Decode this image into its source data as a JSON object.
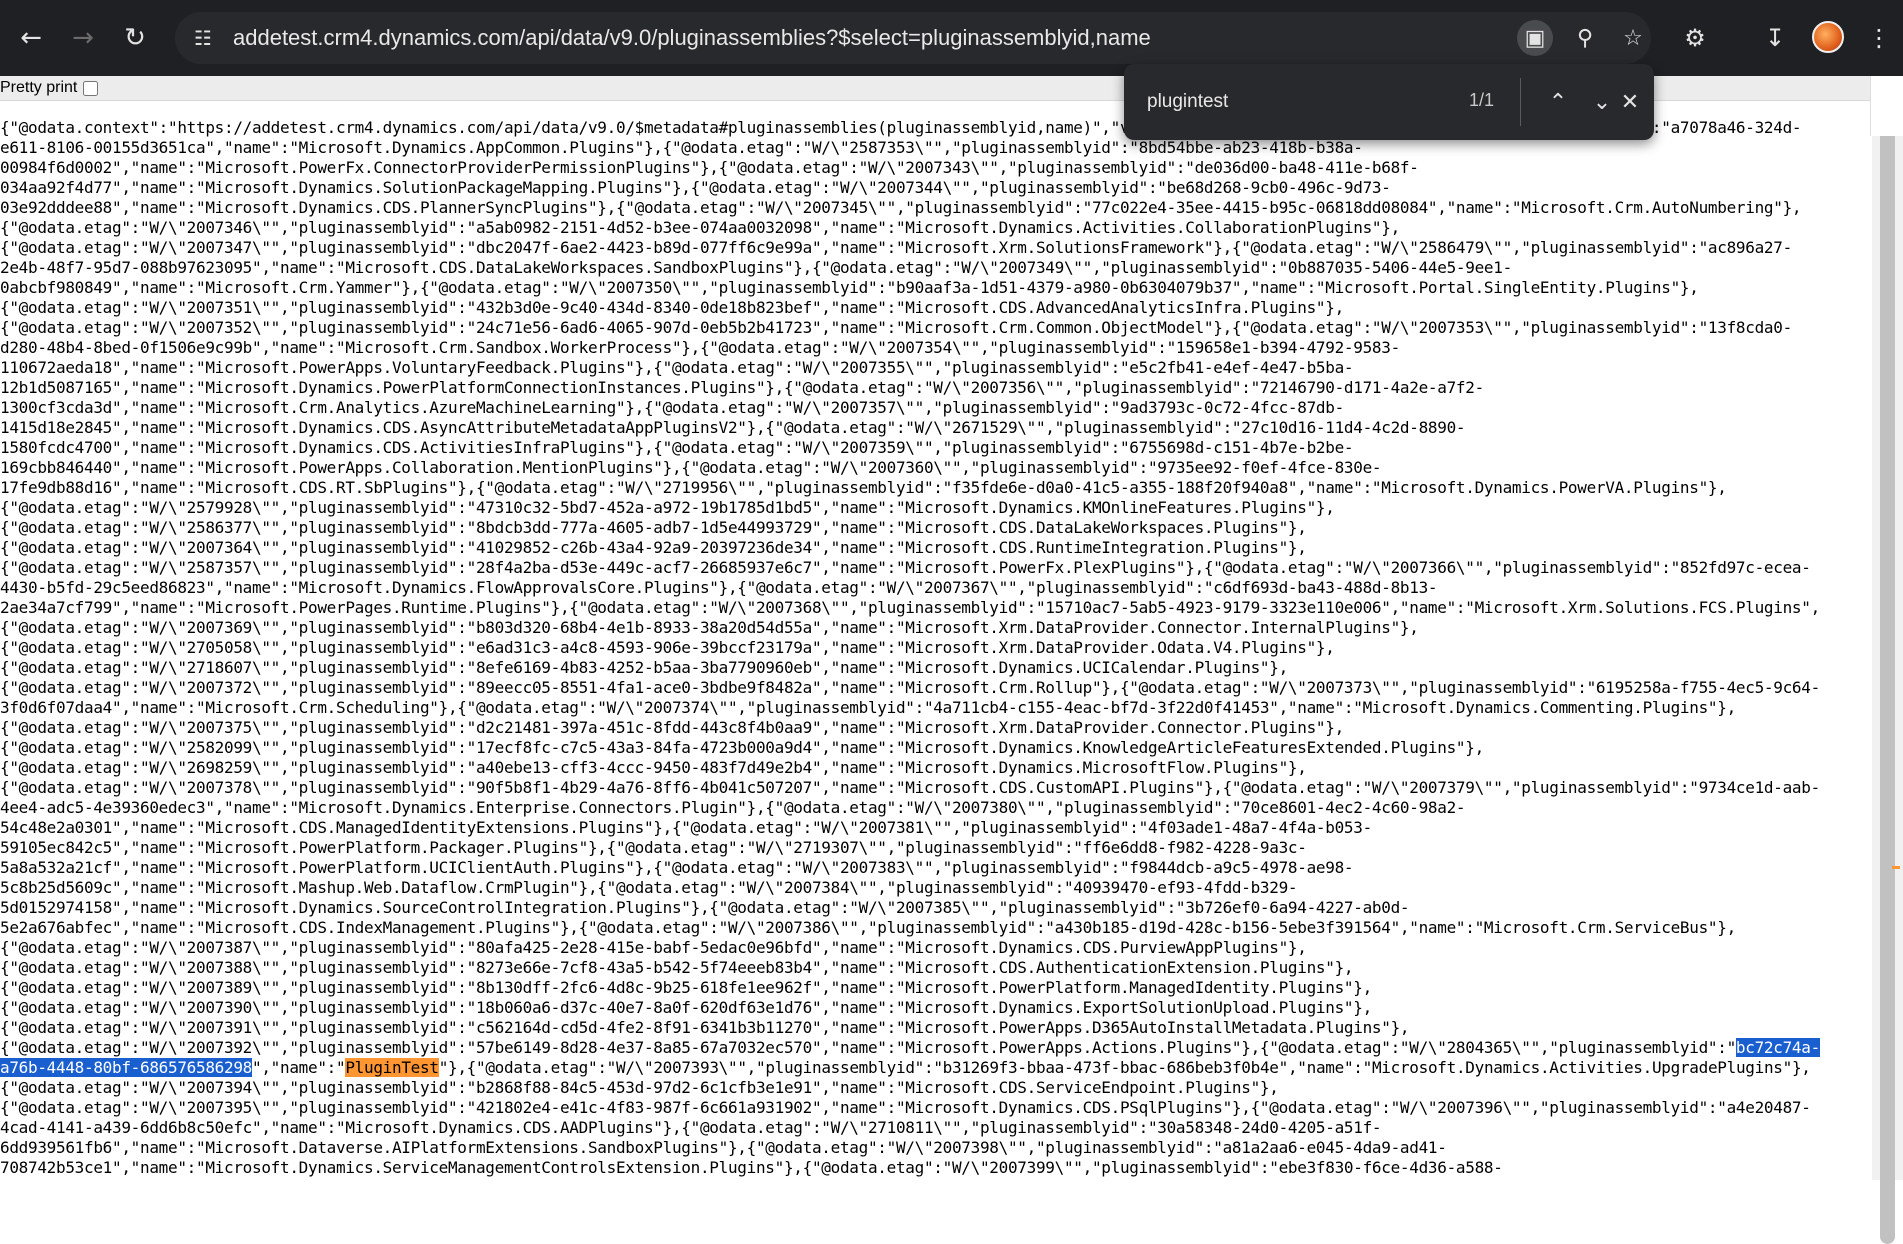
{
  "browser": {
    "url": "addetest.crm4.dynamics.com/api/data/v9.0/pluginassemblies?$select=pluginassemblyid,name",
    "icons": [
      "back-arrow-icon",
      "forward-arrow-icon",
      "reload-icon",
      "site-info-icon",
      "lens-icon",
      "zoom-icon",
      "bookmark-star-icon",
      "extensions-icon",
      "download-icon",
      "profile-avatar",
      "more-menu-icon"
    ]
  },
  "pretty_print": {
    "label": "Pretty print",
    "checked": false
  },
  "find_bar": {
    "query": "plugintest",
    "count": "1/1"
  },
  "json_text": {
    "lines": [
      "{\"@odata.context\":\"https://addetest.crm4.dynamics.com/api/data/v9.0/$metadata#pluginassemblies(pluginassemblyid,name)\",\"value\":[{\"@odata.etag\":\"W/\\\"2007339\\\"\",\"pluginassemblyid\":\"a7078a46-324d-",
      "e611-8106-00155d3651ca\",\"name\":\"Microsoft.Dynamics.AppCommon.Plugins\"},{\"@odata.etag\":\"W/\\\"2587353\\\"\",\"pluginassemblyid\":\"8bd54bbe-ab23-418b-b38a-",
      "00984f6d0002\",\"name\":\"Microsoft.PowerFx.ConnectorProviderPermissionPlugins\"},{\"@odata.etag\":\"W/\\\"2007343\\\"\",\"pluginassemblyid\":\"de036d00-ba48-411e-b68f-",
      "034aa92f4d77\",\"name\":\"Microsoft.Dynamics.SolutionPackageMapping.Plugins\"},{\"@odata.etag\":\"W/\\\"2007344\\\"\",\"pluginassemblyid\":\"be68d268-9cb0-496c-9d73-",
      "03e92dddee88\",\"name\":\"Microsoft.Dynamics.CDS.PlannerSyncPlugins\"},{\"@odata.etag\":\"W/\\\"2007345\\\"\",\"pluginassemblyid\":\"77c022e4-35ee-4415-b95c-06818dd08084\",\"name\":\"Microsoft.Crm.AutoNumbering\"},",
      "{\"@odata.etag\":\"W/\\\"2007346\\\"\",\"pluginassemblyid\":\"a5ab0982-2151-4d52-b3ee-074aa0032098\",\"name\":\"Microsoft.Dynamics.Activities.CollaborationPlugins\"},",
      "{\"@odata.etag\":\"W/\\\"2007347\\\"\",\"pluginassemblyid\":\"dbc2047f-6ae2-4423-b89d-077ff6c9e99a\",\"name\":\"Microsoft.Xrm.SolutionsFramework\"},{\"@odata.etag\":\"W/\\\"2586479\\\"\",\"pluginassemblyid\":\"ac896a27-",
      "2e4b-48f7-95d7-088b97623095\",\"name\":\"Microsoft.CDS.DataLakeWorkspaces.SandboxPlugins\"},{\"@odata.etag\":\"W/\\\"2007349\\\"\",\"pluginassemblyid\":\"0b887035-5406-44e5-9ee1-",
      "0abcbf980849\",\"name\":\"Microsoft.Crm.Yammer\"},{\"@odata.etag\":\"W/\\\"2007350\\\"\",\"pluginassemblyid\":\"b90aaf3a-1d51-4379-a980-0b6304079b37\",\"name\":\"Microsoft.Portal.SingleEntity.Plugins\"},",
      "{\"@odata.etag\":\"W/\\\"2007351\\\"\",\"pluginassemblyid\":\"432b3d0e-9c40-434d-8340-0de18b823bef\",\"name\":\"Microsoft.CDS.AdvancedAnalyticsInfra.Plugins\"},",
      "{\"@odata.etag\":\"W/\\\"2007352\\\"\",\"pluginassemblyid\":\"24c71e56-6ad6-4065-907d-0eb5b2b41723\",\"name\":\"Microsoft.Crm.Common.ObjectModel\"},{\"@odata.etag\":\"W/\\\"2007353\\\"\",\"pluginassemblyid\":\"13f8cda0-",
      "d280-48b4-8bed-0f1506e9c99b\",\"name\":\"Microsoft.Crm.Sandbox.WorkerProcess\"},{\"@odata.etag\":\"W/\\\"2007354\\\"\",\"pluginassemblyid\":\"159658e1-b394-4792-9583-",
      "110672aeda18\",\"name\":\"Microsoft.PowerApps.VoluntaryFeedback.Plugins\"},{\"@odata.etag\":\"W/\\\"2007355\\\"\",\"pluginassemblyid\":\"e5c2fb41-e4ef-4e47-b5ba-",
      "12b1d5087165\",\"name\":\"Microsoft.Dynamics.PowerPlatformConnectionInstances.Plugins\"},{\"@odata.etag\":\"W/\\\"2007356\\\"\",\"pluginassemblyid\":\"72146790-d171-4a2e-a7f2-",
      "1300cf3cda3d\",\"name\":\"Microsoft.Crm.Analytics.AzureMachineLearning\"},{\"@odata.etag\":\"W/\\\"2007357\\\"\",\"pluginassemblyid\":\"9ad3793c-0c72-4fcc-87db-",
      "1415d18e2845\",\"name\":\"Microsoft.Dynamics.CDS.AsyncAttributeMetadataAppPluginsV2\"},{\"@odata.etag\":\"W/\\\"2671529\\\"\",\"pluginassemblyid\":\"27c10d16-11d4-4c2d-8890-",
      "1580fcdc4700\",\"name\":\"Microsoft.Dynamics.CDS.ActivitiesInfraPlugins\"},{\"@odata.etag\":\"W/\\\"2007359\\\"\",\"pluginassemblyid\":\"6755698d-c151-4b7e-b2be-",
      "169cbb846440\",\"name\":\"Microsoft.PowerApps.Collaboration.MentionPlugins\"},{\"@odata.etag\":\"W/\\\"2007360\\\"\",\"pluginassemblyid\":\"9735ee92-f0ef-4fce-830e-",
      "17fe9db88d16\",\"name\":\"Microsoft.CDS.RT.SbPlugins\"},{\"@odata.etag\":\"W/\\\"2719956\\\"\",\"pluginassemblyid\":\"f35fde6e-d0a0-41c5-a355-188f20f940a8\",\"name\":\"Microsoft.Dynamics.PowerVA.Plugins\"},",
      "{\"@odata.etag\":\"W/\\\"2579928\\\"\",\"pluginassemblyid\":\"47310c32-5bd7-452a-a972-19b1785d1bd5\",\"name\":\"Microsoft.Dynamics.KMOnlineFeatures.Plugins\"},",
      "{\"@odata.etag\":\"W/\\\"2586377\\\"\",\"pluginassemblyid\":\"8bdcb3dd-777a-4605-adb7-1d5e44993729\",\"name\":\"Microsoft.CDS.DataLakeWorkspaces.Plugins\"},",
      "{\"@odata.etag\":\"W/\\\"2007364\\\"\",\"pluginassemblyid\":\"41029852-c26b-43a4-92a9-20397236de34\",\"name\":\"Microsoft.CDS.RuntimeIntegration.Plugins\"},",
      "{\"@odata.etag\":\"W/\\\"2587357\\\"\",\"pluginassemblyid\":\"28f4a2ba-d53e-449c-acf7-26685937e6c7\",\"name\":\"Microsoft.PowerFx.PlexPlugins\"},{\"@odata.etag\":\"W/\\\"2007366\\\"\",\"pluginassemblyid\":\"852fd97c-ecea-",
      "4430-b5fd-29c5eed86823\",\"name\":\"Microsoft.Dynamics.FlowApprovalsCore.Plugins\"},{\"@odata.etag\":\"W/\\\"2007367\\\"\",\"pluginassemblyid\":\"c6df693d-ba43-488d-8b13-",
      "2ae34a7cf799\",\"name\":\"Microsoft.PowerPages.Runtime.Plugins\"},{\"@odata.etag\":\"W/\\\"2007368\\\"\",\"pluginassemblyid\":\"15710ac7-5ab5-4923-9179-3323e110e006\",\"name\":\"Microsoft.Xrm.Solutions.FCS.Plugins\",",
      "{\"@odata.etag\":\"W/\\\"2007369\\\"\",\"pluginassemblyid\":\"b803d320-68b4-4e1b-8933-38a20d54d55a\",\"name\":\"Microsoft.Xrm.DataProvider.Connector.InternalPlugins\"},",
      "{\"@odata.etag\":\"W/\\\"2705058\\\"\",\"pluginassemblyid\":\"e6ad31c3-a4c8-4593-906e-39bccf23179a\",\"name\":\"Microsoft.Xrm.DataProvider.Odata.V4.Plugins\"},",
      "{\"@odata.etag\":\"W/\\\"2718607\\\"\",\"pluginassemblyid\":\"8efe6169-4b83-4252-b5aa-3ba7790960eb\",\"name\":\"Microsoft.Dynamics.UCICalendar.Plugins\"},",
      "{\"@odata.etag\":\"W/\\\"2007372\\\"\",\"pluginassemblyid\":\"89eecc05-8551-4fa1-ace0-3bdbe9f8482a\",\"name\":\"Microsoft.Crm.Rollup\"},{\"@odata.etag\":\"W/\\\"2007373\\\"\",\"pluginassemblyid\":\"6195258a-f755-4ec5-9c64-",
      "3f0d6f07daa4\",\"name\":\"Microsoft.Crm.Scheduling\"},{\"@odata.etag\":\"W/\\\"2007374\\\"\",\"pluginassemblyid\":\"4a711cb4-c155-4eac-bf7d-3f22d0f41453\",\"name\":\"Microsoft.Dynamics.Commenting.Plugins\"},",
      "{\"@odata.etag\":\"W/\\\"2007375\\\"\",\"pluginassemblyid\":\"d2c21481-397a-451c-8fdd-443c8f4b0aa9\",\"name\":\"Microsoft.Xrm.DataProvider.Connector.Plugins\"},",
      "{\"@odata.etag\":\"W/\\\"2582099\\\"\",\"pluginassemblyid\":\"17ecf8fc-c7c5-43a3-84fa-4723b000a9d4\",\"name\":\"Microsoft.Dynamics.KnowledgeArticleFeaturesExtended.Plugins\"},",
      "{\"@odata.etag\":\"W/\\\"2698259\\\"\",\"pluginassemblyid\":\"a40ebe13-cff3-4ccc-9450-483f7d49e2b4\",\"name\":\"Microsoft.Dynamics.MicrosoftFlow.Plugins\"},",
      "{\"@odata.etag\":\"W/\\\"2007378\\\"\",\"pluginassemblyid\":\"90f5b8f1-4b29-4a76-8ff6-4b041c507207\",\"name\":\"Microsoft.CDS.CustomAPI.Plugins\"},{\"@odata.etag\":\"W/\\\"2007379\\\"\",\"pluginassemblyid\":\"9734ce1d-aab-",
      "4ee4-adc5-4e39360edec3\",\"name\":\"Microsoft.Dynamics.Enterprise.Connectors.Plugin\"},{\"@odata.etag\":\"W/\\\"2007380\\\"\",\"pluginassemblyid\":\"70ce8601-4ec2-4c60-98a2-",
      "54c48e2a0301\",\"name\":\"Microsoft.CDS.ManagedIdentityExtensions.Plugins\"},{\"@odata.etag\":\"W/\\\"2007381\\\"\",\"pluginassemblyid\":\"4f03ade1-48a7-4f4a-b053-",
      "59105ec842c5\",\"name\":\"Microsoft.PowerPlatform.Packager.Plugins\"},{\"@odata.etag\":\"W/\\\"2719307\\\"\",\"pluginassemblyid\":\"ff6e6dd8-f982-4228-9a3c-",
      "5a8a532a21cf\",\"name\":\"Microsoft.PowerPlatform.UCIClientAuth.Plugins\"},{\"@odata.etag\":\"W/\\\"2007383\\\"\",\"pluginassemblyid\":\"f9844dcb-a9c5-4978-ae98-",
      "5c8b25d5609c\",\"name\":\"Microsoft.Mashup.Web.Dataflow.CrmPlugin\"},{\"@odata.etag\":\"W/\\\"2007384\\\"\",\"pluginassemblyid\":\"40939470-ef93-4fdd-b329-",
      "5d0152974158\",\"name\":\"Microsoft.Dynamics.SourceControlIntegration.Plugins\"},{\"@odata.etag\":\"W/\\\"2007385\\\"\",\"pluginassemblyid\":\"3b726ef0-6a94-4227-ab0d-",
      "5e2a676abfec\",\"name\":\"Microsoft.CDS.IndexManagement.Plugins\"},{\"@odata.etag\":\"W/\\\"2007386\\\"\",\"pluginassemblyid\":\"a430b185-d19d-428c-b156-5ebe3f391564\",\"name\":\"Microsoft.Crm.ServiceBus\"},",
      "{\"@odata.etag\":\"W/\\\"2007387\\\"\",\"pluginassemblyid\":\"80afa425-2e28-415e-babf-5edac0e96bfd\",\"name\":\"Microsoft.Dynamics.CDS.PurviewAppPlugins\"},",
      "{\"@odata.etag\":\"W/\\\"2007388\\\"\",\"pluginassemblyid\":\"8273e66e-7cf8-43a5-b542-5f74eeeb83b4\",\"name\":\"Microsoft.CDS.AuthenticationExtension.Plugins\"},",
      "{\"@odata.etag\":\"W/\\\"2007389\\\"\",\"pluginassemblyid\":\"8b130dff-2fc6-4d8c-9b25-618fe1ee962f\",\"name\":\"Microsoft.PowerPlatform.ManagedIdentity.Plugins\"},",
      "{\"@odata.etag\":\"W/\\\"2007390\\\"\",\"pluginassemblyid\":\"18b060a6-d37c-40e7-8a0f-620df63e1d76\",\"name\":\"Microsoft.Dynamics.ExportSolutionUpload.Plugins\"},",
      "{\"@odata.etag\":\"W/\\\"2007391\\\"\",\"pluginassemblyid\":\"c562164d-cd5d-4fe2-8f91-6341b3b11270\",\"name\":\"Microsoft.PowerApps.D365AutoInstallMetadata.Plugins\"},"
    ],
    "match_line_a": "{\"@odata.etag\":\"W/\\\"2007392\\\"\",\"pluginassemblyid\":\"57be6149-8d28-4e37-8a85-67a7032ec570\",\"name\":\"Microsoft.PowerApps.Actions.Plugins\"},{\"@odata.etag\":\"W/\\\"2804365\\\"\",\"pluginassemblyid\":\"",
    "match_sel_a": "bc72c74a-",
    "match_sel_b": "a76b-4448-80bf-686576586298",
    "match_mid": "\",\"name\":\"",
    "match_word": "PluginTest",
    "match_rest": "\"},{\"@odata.etag\":\"W/\\\"2007393\\\"\",\"pluginassemblyid\":\"b31269f3-bbaa-473f-bbac-686beb3f0b4e\",\"name\":\"Microsoft.Dynamics.Activities.UpgradePlugins\"},",
    "lines_after": [
      "{\"@odata.etag\":\"W/\\\"2007394\\\"\",\"pluginassemblyid\":\"b2868f88-84c5-453d-97d2-6c1cfb3e1e91\",\"name\":\"Microsoft.CDS.ServiceEndpoint.Plugins\"},",
      "{\"@odata.etag\":\"W/\\\"2007395\\\"\",\"pluginassemblyid\":\"421802e4-e41c-4f83-987f-6c661a931902\",\"name\":\"Microsoft.Dynamics.CDS.PSqlPlugins\"},{\"@odata.etag\":\"W/\\\"2007396\\\"\",\"pluginassemblyid\":\"a4e20487-",
      "4cad-4141-a439-6dd6b8c50efc\",\"name\":\"Microsoft.Dynamics.CDS.AADPlugins\"},{\"@odata.etag\":\"W/\\\"2710811\\\"\",\"pluginassemblyid\":\"30a58348-24d0-4205-a51f-",
      "6dd939561fb6\",\"name\":\"Microsoft.Dataverse.AIPlatformExtensions.SandboxPlugins\"},{\"@odata.etag\":\"W/\\\"2007398\\\"\",\"pluginassemblyid\":\"a81a2aa6-e045-4da9-ad41-",
      "708742b53ce1\",\"name\":\"Microsoft.Dynamics.ServiceManagementControlsExtension.Plugins\"},{\"@odata.etag\":\"W/\\\"2007399\\\"\",\"pluginassemblyid\":\"ebe3f830-f6ce-4d36-a588-"
    ]
  }
}
